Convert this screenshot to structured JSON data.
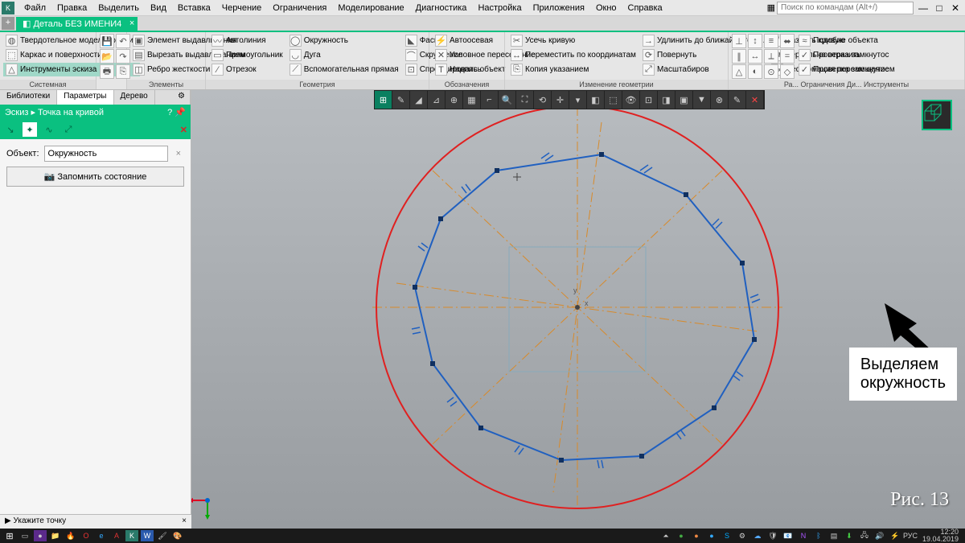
{
  "menu": [
    "Файл",
    "Правка",
    "Выделить",
    "Вид",
    "Вставка",
    "Черчение",
    "Ограничения",
    "Моделирование",
    "Диагностика",
    "Настройка",
    "Приложения",
    "Окно",
    "Справка"
  ],
  "search_placeholder": "Поиск по командам (Alt+/)",
  "doc_tab": "Деталь БЕЗ ИМЕНИ4",
  "ribbon": {
    "g1": {
      "label": "Системная",
      "items": [
        "Твердотельное моделирование",
        "Каркас и поверхности",
        "Инструменты эскиза"
      ]
    },
    "g2": {
      "label": "Элементы",
      "items": [
        "Элемент выдавливания",
        "Вырезать выдавливанием",
        "Ребро жесткости"
      ]
    },
    "g3": {
      "label": "Геометрия",
      "items": [
        "Автолиния",
        "Прямоугольник",
        "Отрезок",
        "Окружность",
        "Дуга",
        "Вспомогательная прямая",
        "Фаска",
        "Скругление",
        "Спроецировать объект"
      ]
    },
    "g4": {
      "label": "Обозначения",
      "items": [
        "Автоосевая",
        "Условное пересечение",
        "Надпись"
      ]
    },
    "g5": {
      "label": "Изменение геометрии",
      "items": [
        "Усечь кривую",
        "Переместить по координатам",
        "Копия указанием",
        "Удлинить до ближайшего о...",
        "Повернуть",
        "Масштабиров",
        "Разбить кривую",
        "Зеркально отразить",
        "Деформация перемещением"
      ]
    },
    "g6": {
      "label": "Ра...  Ограничения  Ди...  Инструменты",
      "items": [
        "Подобие объекта",
        "Проверка замкнутос",
        "Проверка замкнутос"
      ]
    }
  },
  "leftpanel": {
    "tabs": [
      "Библиотеки",
      "Параметры",
      "Дерево"
    ],
    "crumb": "Эскиз  ▸  Точка на кривой",
    "object_label": "Объект:",
    "object_value": "Окружность",
    "btn": "Запомнить состояние",
    "hint": "Укажите точку"
  },
  "annotation": {
    "line1": "Выделяем",
    "line2": "окружность"
  },
  "figlabel": "Рис. 13",
  "clock": {
    "time": "12:20",
    "date": "19.04.2019",
    "lang": "РУС"
  }
}
